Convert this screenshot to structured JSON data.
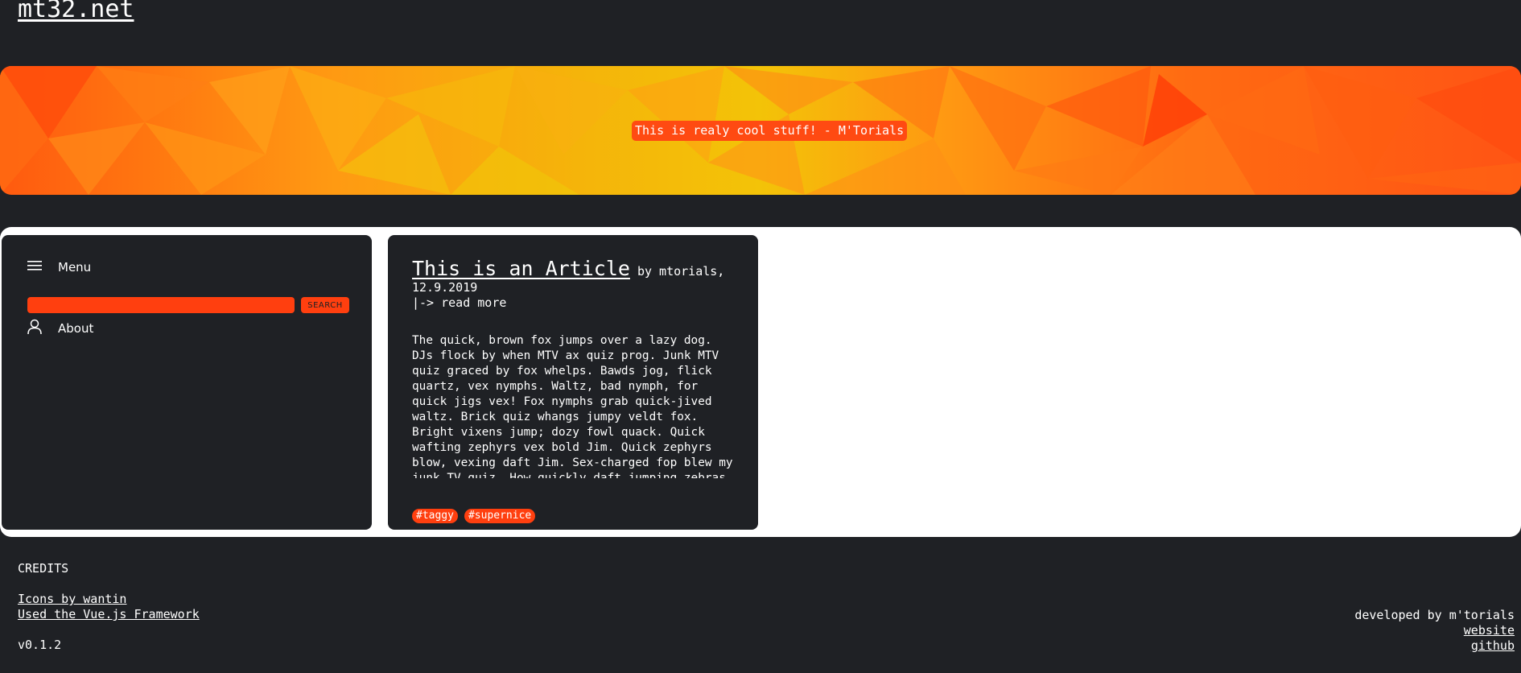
{
  "header": {
    "site_title": "mt32.net"
  },
  "hero": {
    "quote": "This is realy cool stuff! - M'Torials"
  },
  "sidebar": {
    "menu_label": "Menu",
    "search_placeholder": "",
    "search_button": "SEARCH",
    "about_label": "About"
  },
  "article": {
    "title": "This is an Article",
    "byline": " by mtorials, 12.9.2019",
    "read_more": "|-> read more",
    "body": "The quick, brown fox jumps over a lazy dog. DJs flock by when MTV ax quiz prog. Junk MTV quiz graced by fox whelps. Bawds jog, flick quartz, vex nymphs. Waltz, bad nymph, for quick jigs vex! Fox nymphs grab quick-jived waltz. Brick quiz whangs jumpy veldt fox. Bright vixens jump; dozy fowl quack. Quick wafting zephyrs vex bold Jim. Quick zephyrs blow, vexing daft Jim. Sex-charged fop blew my junk TV quiz. How quickly daft jumping zebras vex. Two driven jocks help fax my big quiz.",
    "tags": [
      "#taggy",
      "#supernice"
    ]
  },
  "footer": {
    "credits_heading": "CREDITS",
    "icons_credit": "Icons by wantin",
    "framework_credit": "Used the Vue.js Framework",
    "version": "v0.1.2",
    "developed_by": "developed by m'torials",
    "website_link": "website",
    "github_link": "github"
  },
  "colors": {
    "background": "#1f2125",
    "accent": "#ff3f0f",
    "content_area": "#ffffff"
  },
  "icons": {
    "menu": "hamburger-icon",
    "about": "user-icon"
  }
}
